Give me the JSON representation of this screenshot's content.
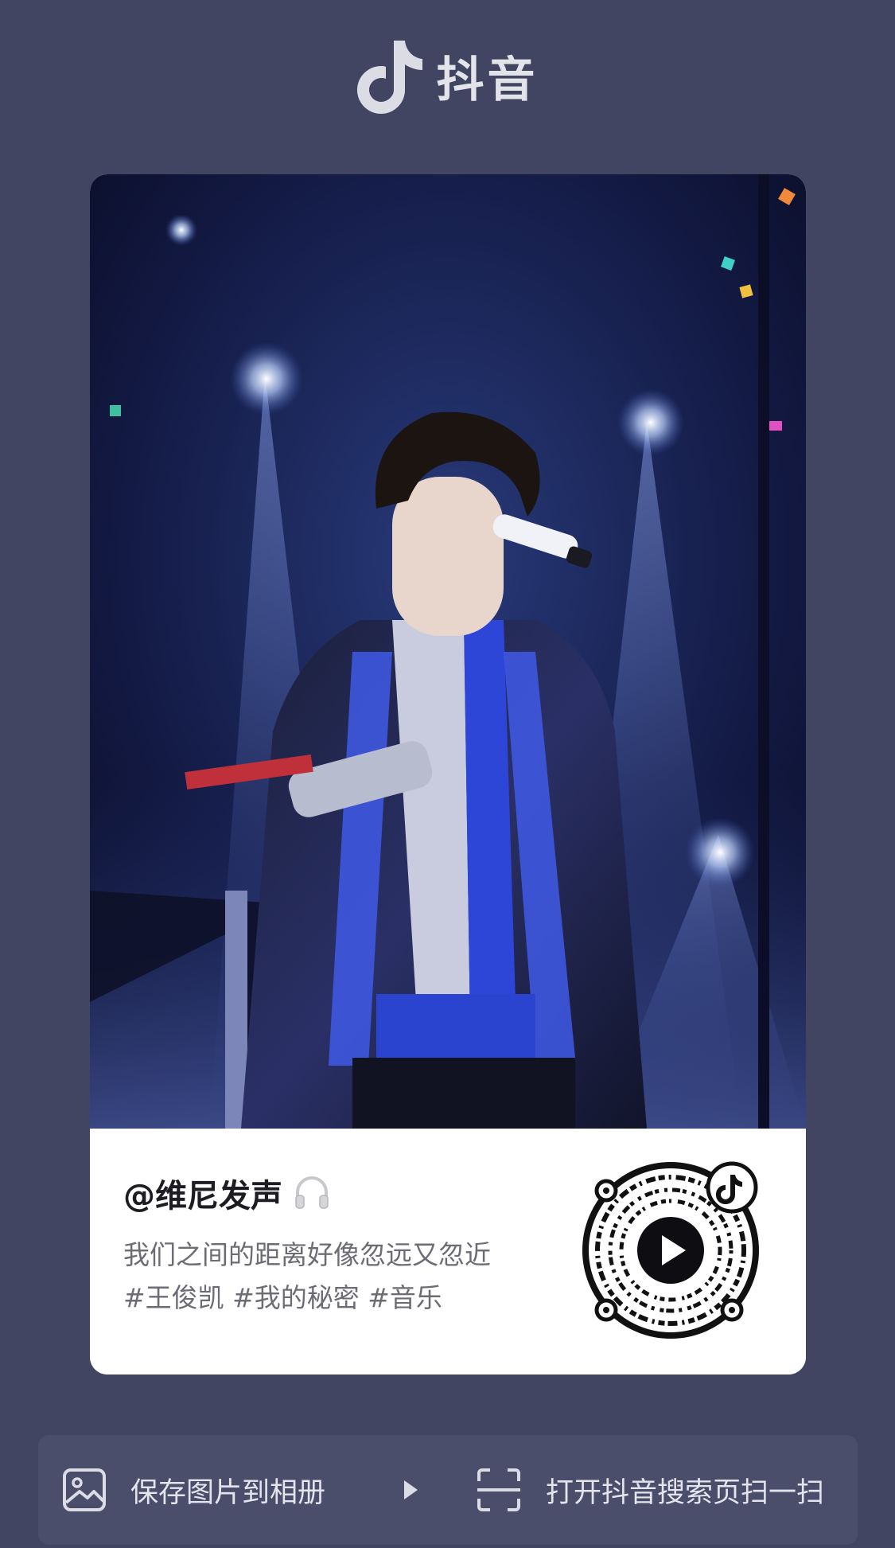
{
  "header": {
    "app_name": "抖音",
    "logo_icon": "douyin-note-icon"
  },
  "card": {
    "username": "@维尼发声",
    "username_icon": "headphone-icon",
    "description": "我们之间的距离好像忽远又忽近",
    "hashtags": "#王俊凯 #我的秘密 #音乐",
    "qr_icon": "qr-code-with-play-icon"
  },
  "bottom_bar": {
    "save_label": "保存图片到相册",
    "save_icon": "image-icon",
    "arrow_icon": "triangle-right-icon",
    "scan_label": "打开抖音搜索页扫一扫",
    "scan_icon": "scan-frame-icon"
  },
  "colors": {
    "background": "#424561",
    "bar": "#4b4e6a",
    "card": "#ffffff",
    "description": "#6c6c74"
  }
}
